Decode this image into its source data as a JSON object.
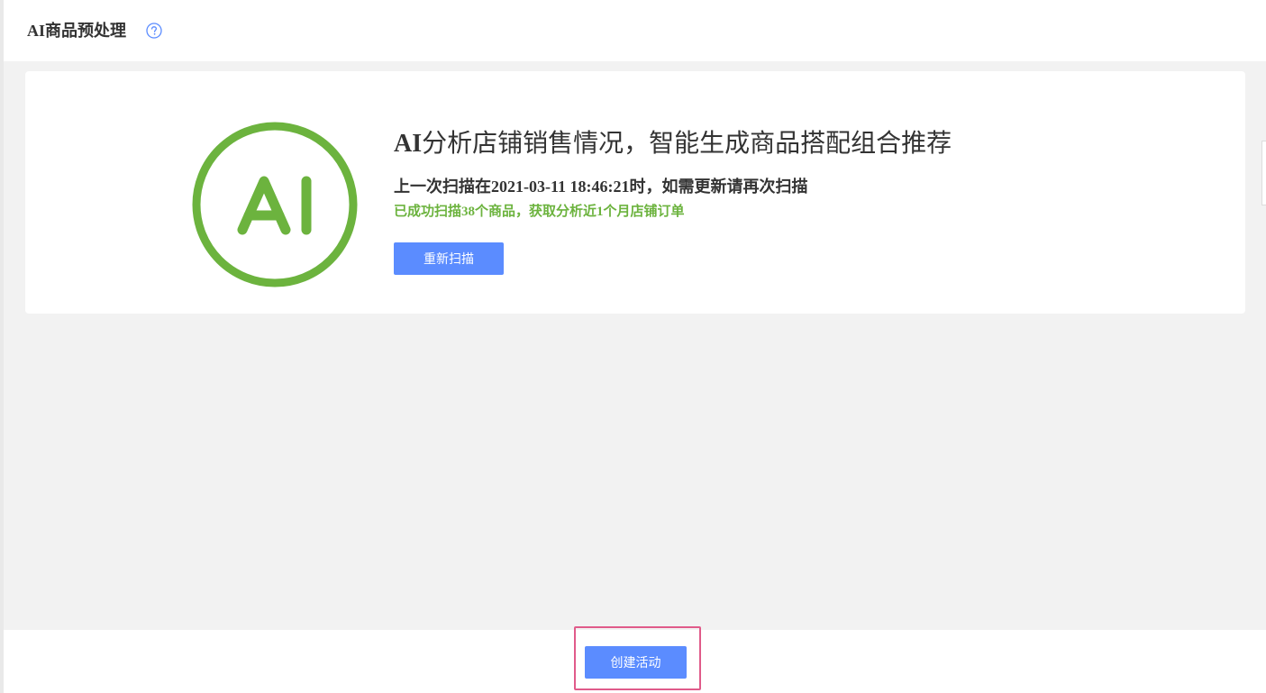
{
  "header": {
    "title": "AI商品预处理",
    "help_icon": "question-circle-icon"
  },
  "card": {
    "logo_text": "AI",
    "title_prefix": "AI",
    "title_rest": "分析店铺销售情况，智能生成商品搭配组合推荐",
    "scan_info": "上一次扫描在2021-03-11 18:46:21时，如需更新请再次扫描",
    "scan_result": "已成功扫描38个商品，获取分析近1个月店铺订单",
    "rescan_label": "重新扫描"
  },
  "footer": {
    "create_label": "创建活动"
  },
  "colors": {
    "accent": "#5b8cff",
    "logo_green": "#6cb33e",
    "highlight": "#e05b8a",
    "background": "#f2f2f2"
  }
}
